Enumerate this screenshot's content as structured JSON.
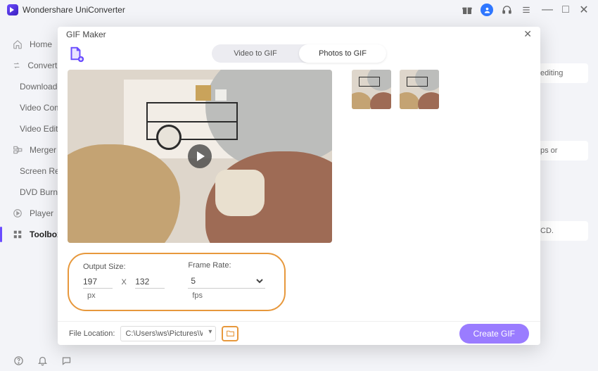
{
  "app": {
    "title": "Wondershare UniConverter"
  },
  "titlebar_icons": {
    "gift": "gift-icon",
    "user": "user-icon",
    "support": "headset-icon",
    "menu": "menu-icon",
    "min": "—",
    "max": "□",
    "close": "✕"
  },
  "sidebar": {
    "items": [
      {
        "icon": "home-icon",
        "label": "Home"
      },
      {
        "icon": "converter-icon",
        "label": "Converter"
      },
      {
        "icon": "downloader-icon",
        "label": "Downloader"
      },
      {
        "icon": "compressor-icon",
        "label": "Video Compressor"
      },
      {
        "icon": "editor-icon",
        "label": "Video Editor"
      },
      {
        "icon": "merger-icon",
        "label": "Merger"
      },
      {
        "icon": "recorder-icon",
        "label": "Screen Recorder"
      },
      {
        "icon": "dvd-icon",
        "label": "DVD Burner"
      },
      {
        "icon": "player-icon",
        "label": "Player"
      },
      {
        "icon": "toolbox-icon",
        "label": "Toolbox"
      }
    ],
    "active_index": 9
  },
  "background_snippets": {
    "a": "editing",
    "b": "ps or",
    "c": "CD."
  },
  "modal": {
    "title": "GIF Maker",
    "tabs": {
      "left": "Video to GIF",
      "right": "Photos to GIF",
      "active": "right"
    },
    "add_tooltip": "Add photos",
    "settings": {
      "output_size_label": "Output Size:",
      "width": "197",
      "height": "132",
      "size_unit": "px",
      "frame_rate_label": "Frame Rate:",
      "frame_rate": "5",
      "rate_unit": "fps"
    },
    "footer": {
      "location_label": "File Location:",
      "path": "C:\\Users\\ws\\Pictures\\Wondersh",
      "create_label": "Create GIF"
    }
  },
  "bottombar": {
    "help": "?",
    "bell": "bell",
    "feedback": "chat"
  }
}
